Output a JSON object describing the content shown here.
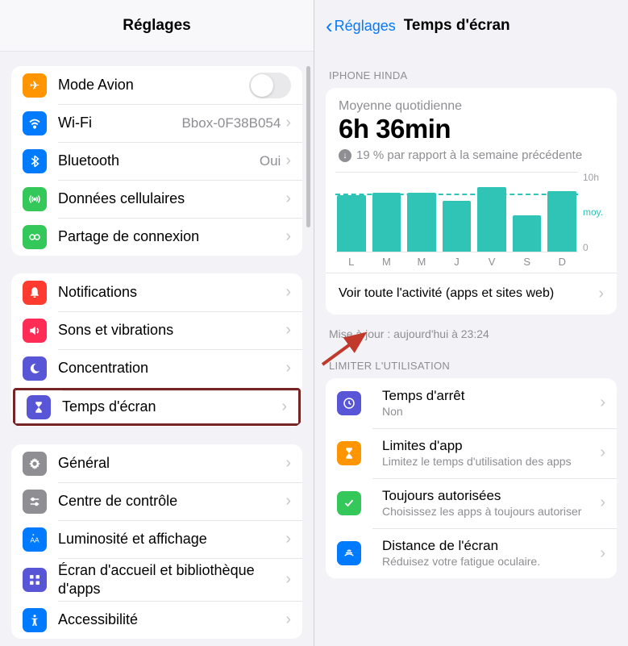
{
  "left": {
    "title": "Réglages",
    "group1": [
      {
        "label": "Mode Avion",
        "iconColor": "#ff9500"
      },
      {
        "label": "Wi-Fi",
        "value": "Bbox-0F38B054",
        "iconColor": "#007aff"
      },
      {
        "label": "Bluetooth",
        "value": "Oui",
        "iconColor": "#007aff"
      },
      {
        "label": "Données cellulaires",
        "iconColor": "#34c759"
      },
      {
        "label": "Partage de connexion",
        "iconColor": "#34c759"
      }
    ],
    "group2": [
      {
        "label": "Notifications",
        "iconColor": "#ff3b30"
      },
      {
        "label": "Sons et vibrations",
        "iconColor": "#ff2d55"
      },
      {
        "label": "Concentration",
        "iconColor": "#5856d6"
      },
      {
        "label": "Temps d'écran",
        "iconColor": "#5856d6",
        "highlighted": true
      }
    ],
    "group3": [
      {
        "label": "Général",
        "iconColor": "#8e8e93"
      },
      {
        "label": "Centre de contrôle",
        "iconColor": "#8e8e93"
      },
      {
        "label": "Luminosité et affichage",
        "iconColor": "#007aff"
      },
      {
        "label": "Écran d'accueil et bibliothèque d'apps",
        "iconColor": "#5856d6"
      },
      {
        "label": "Accessibilité",
        "iconColor": "#007aff"
      }
    ]
  },
  "right": {
    "backLabel": "Réglages",
    "title": "Temps d'écran",
    "deviceHeader": "IPHONE HINDA",
    "avgLabel": "Moyenne quotidienne",
    "bigTime": "6h 36min",
    "deltaText": "19 % par rapport à la semaine précédente",
    "linkText": "Voir toute l'activité (apps et sites web)",
    "updatedText": "Mise à jour : aujourd'hui à 23:24",
    "limitHeader": "LIMITER L'UTILISATION",
    "limitRows": [
      {
        "label": "Temps d'arrêt",
        "sub": "Non",
        "iconColor": "#5856d6"
      },
      {
        "label": "Limites d'app",
        "sub": "Limitez le temps d'utilisation des apps",
        "iconColor": "#ff9500"
      },
      {
        "label": "Toujours autorisées",
        "sub": "Choisissez les apps à toujours autoriser",
        "iconColor": "#34c759"
      },
      {
        "label": "Distance de l'écran",
        "sub": "Réduisez votre fatigue oculaire.",
        "iconColor": "#007aff"
      }
    ]
  },
  "chart_data": {
    "type": "bar",
    "categories": [
      "L",
      "M",
      "M",
      "J",
      "V",
      "S",
      "D"
    ],
    "values": [
      7.0,
      7.3,
      7.3,
      6.3,
      8.0,
      4.5,
      7.5
    ],
    "title": "Moyenne quotidienne",
    "xlabel": "",
    "ylabel": "",
    "ylim": [
      0,
      10
    ],
    "avg_line": 7.3,
    "ytick_top": "10h",
    "ytick_mid": "moy.",
    "ytick_bot": "0"
  }
}
